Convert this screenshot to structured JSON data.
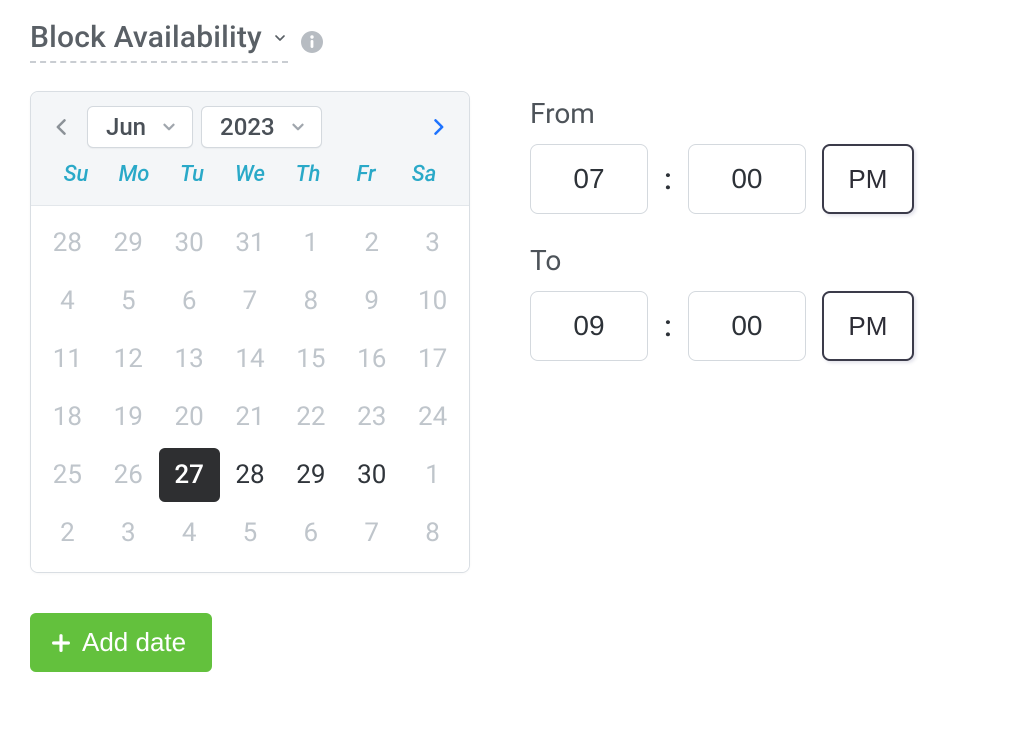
{
  "header": {
    "title": "Block Availability"
  },
  "calendar": {
    "month_label": "Jun",
    "year_label": "2023",
    "days_of_week": [
      "Su",
      "Mo",
      "Tu",
      "We",
      "Th",
      "Fr",
      "Sa"
    ],
    "cells": [
      {
        "d": "28",
        "muted": true,
        "sel": false
      },
      {
        "d": "29",
        "muted": true,
        "sel": false
      },
      {
        "d": "30",
        "muted": true,
        "sel": false
      },
      {
        "d": "31",
        "muted": true,
        "sel": false
      },
      {
        "d": "1",
        "muted": true,
        "sel": false
      },
      {
        "d": "2",
        "muted": true,
        "sel": false
      },
      {
        "d": "3",
        "muted": true,
        "sel": false
      },
      {
        "d": "4",
        "muted": true,
        "sel": false
      },
      {
        "d": "5",
        "muted": true,
        "sel": false
      },
      {
        "d": "6",
        "muted": true,
        "sel": false
      },
      {
        "d": "7",
        "muted": true,
        "sel": false
      },
      {
        "d": "8",
        "muted": true,
        "sel": false
      },
      {
        "d": "9",
        "muted": true,
        "sel": false
      },
      {
        "d": "10",
        "muted": true,
        "sel": false
      },
      {
        "d": "11",
        "muted": true,
        "sel": false
      },
      {
        "d": "12",
        "muted": true,
        "sel": false
      },
      {
        "d": "13",
        "muted": true,
        "sel": false
      },
      {
        "d": "14",
        "muted": true,
        "sel": false
      },
      {
        "d": "15",
        "muted": true,
        "sel": false
      },
      {
        "d": "16",
        "muted": true,
        "sel": false
      },
      {
        "d": "17",
        "muted": true,
        "sel": false
      },
      {
        "d": "18",
        "muted": true,
        "sel": false
      },
      {
        "d": "19",
        "muted": true,
        "sel": false
      },
      {
        "d": "20",
        "muted": true,
        "sel": false
      },
      {
        "d": "21",
        "muted": true,
        "sel": false
      },
      {
        "d": "22",
        "muted": true,
        "sel": false
      },
      {
        "d": "23",
        "muted": true,
        "sel": false
      },
      {
        "d": "24",
        "muted": true,
        "sel": false
      },
      {
        "d": "25",
        "muted": true,
        "sel": false
      },
      {
        "d": "26",
        "muted": true,
        "sel": false
      },
      {
        "d": "27",
        "muted": false,
        "sel": true
      },
      {
        "d": "28",
        "muted": false,
        "sel": false
      },
      {
        "d": "29",
        "muted": false,
        "sel": false
      },
      {
        "d": "30",
        "muted": false,
        "sel": false
      },
      {
        "d": "1",
        "muted": true,
        "sel": false
      },
      {
        "d": "2",
        "muted": true,
        "sel": false
      },
      {
        "d": "3",
        "muted": true,
        "sel": false
      },
      {
        "d": "4",
        "muted": true,
        "sel": false
      },
      {
        "d": "5",
        "muted": true,
        "sel": false
      },
      {
        "d": "6",
        "muted": true,
        "sel": false
      },
      {
        "d": "7",
        "muted": true,
        "sel": false
      },
      {
        "d": "8",
        "muted": true,
        "sel": false
      }
    ]
  },
  "time": {
    "from_label": "From",
    "to_label": "To",
    "from_hour": "07",
    "from_minute": "00",
    "from_ampm": "PM",
    "to_hour": "09",
    "to_minute": "00",
    "to_ampm": "PM"
  },
  "actions": {
    "add_date_label": "Add date"
  }
}
